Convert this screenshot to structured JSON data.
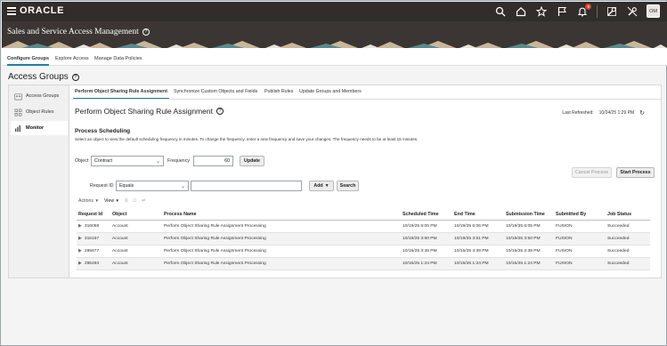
{
  "global": {
    "logo": "ORACLE",
    "notification_count": "9",
    "avatar_initials": "OM",
    "icons": [
      "search-icon",
      "home-icon",
      "star-icon",
      "flag-icon",
      "bell-icon",
      "tools-icon",
      "no-tools-icon"
    ]
  },
  "banner": {
    "title": "Sales and Service Access Management"
  },
  "top_tabs": [
    "Configure Groups",
    "Explore Access",
    "Manage Data Policies"
  ],
  "page_title": "Access Groups",
  "sidenav": [
    "Access Groups",
    "Object Rules",
    "Monitor"
  ],
  "sub_tabs": [
    "Perform Object Sharing Rule Assignment",
    "Synchronize Custom Objects and Fields",
    "Publish Rules",
    "Update Groups and Members"
  ],
  "section": {
    "title": "Perform Object Sharing Rule Assignment",
    "last_refreshed_label": "Last Refreshed:",
    "last_refreshed_value": "10/24/25 1:29 PM",
    "scheduling_heading": "Process Scheduling",
    "instructions": "Select an object to view the default scheduling frequency in minutes. To change the frequency, enter a new frequency and save your changes. The frequency needs to be at least 15 minutes."
  },
  "form": {
    "object_label": "Object",
    "object_value": "Contract",
    "frequency_label": "Frequency",
    "frequency_value": "60",
    "update_label": "Update",
    "cancel_process_label": "Cancel Process",
    "start_process_label": "Start Process",
    "request_id_label": "Request ID",
    "operator_value": "Equals",
    "add_label": "Add",
    "search_label": "Search"
  },
  "toolbar": {
    "actions_label": "Actions",
    "view_label": "View"
  },
  "table": {
    "columns": [
      "Request Id",
      "Object",
      "Process Name",
      "Scheduled Time",
      "End Time",
      "Submission Time",
      "Submitted By",
      "Job Status"
    ],
    "rows": [
      [
        "316058",
        "Account",
        "Perform Object Sharing Rule Assignment Processing",
        "10/19/25 6:05 PM",
        "10/19/25 6:06 PM",
        "10/19/25 6:05 PM",
        "FUSION",
        "Succeeded"
      ],
      [
        "316157",
        "Account",
        "Perform Object Sharing Rule Assignment Processing",
        "10/19/25 3:50 PM",
        "10/19/25 3:51 PM",
        "10/19/25 3:50 PM",
        "FUSION",
        "Succeeded"
      ],
      [
        "295977",
        "Account",
        "Perform Object Sharing Rule Assignment Processing",
        "10/15/25 3:38 PM",
        "10/15/25 3:39 PM",
        "10/15/25 3:38 PM",
        "FUSION",
        "Succeeded"
      ],
      [
        "295494",
        "Account",
        "Perform Object Sharing Rule Assignment Processing",
        "10/15/25 1:24 PM",
        "10/15/25 1:24 PM",
        "10/15/25 1:24 PM",
        "FUSION",
        "Succeeded"
      ]
    ]
  }
}
